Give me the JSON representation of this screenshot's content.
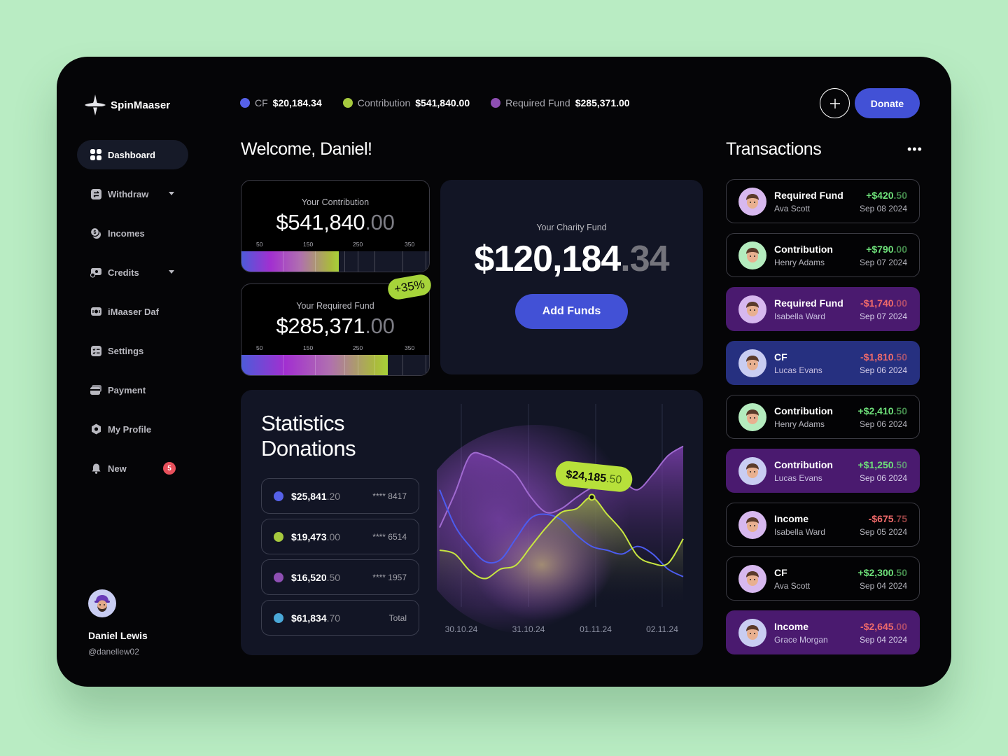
{
  "app": {
    "name": "SpinMaaser",
    "logo_icon": "compass-star-icon"
  },
  "sidebar": {
    "items": [
      {
        "label": "Dashboard",
        "icon": "grid-icon",
        "active": true
      },
      {
        "label": "Withdraw",
        "icon": "swap-icon",
        "has_dropdown": true
      },
      {
        "label": "Incomes",
        "icon": "coins-icon"
      },
      {
        "label": "Credits",
        "icon": "credit-icon",
        "has_dropdown": true
      },
      {
        "label": "iMaaser Daf",
        "icon": "cash-icon"
      },
      {
        "label": "Settings",
        "icon": "checklist-icon"
      },
      {
        "label": "Payment",
        "icon": "card-icon"
      },
      {
        "label": "My Profile",
        "icon": "hexagon-icon"
      },
      {
        "label": "New",
        "icon": "bell-icon",
        "badge": "5"
      }
    ],
    "user": {
      "name": "Daniel Lewis",
      "handle": "@danellew02"
    }
  },
  "topbar": {
    "stats": [
      {
        "label": "CF",
        "value": "$20,184.34",
        "color": "#5661e8"
      },
      {
        "label": "Contribution",
        "value": "$541,840.00",
        "color": "#a6c93e"
      },
      {
        "label": "Required Fund",
        "value": "$285,371.00",
        "color": "#8e4fb3"
      }
    ],
    "donate_label": "Donate"
  },
  "welcome": "Welcome, Daniel!",
  "contribution_card": {
    "title": "Your Contribution",
    "amount_int": "$541,840",
    "amount_dec": ".00",
    "scale": [
      "50",
      "150",
      "250",
      "350"
    ],
    "progress": 0.52
  },
  "required_card": {
    "title": "Your Required Fund",
    "amount_int": "$285,371",
    "amount_dec": ".00",
    "scale": [
      "50",
      "150",
      "250",
      "350"
    ],
    "progress": 0.78,
    "change_badge": "+35%"
  },
  "charity_card": {
    "title": "Your Charity Fund",
    "amount_int": "$120,184",
    "amount_dec": ".34",
    "button": "Add Funds"
  },
  "statistics": {
    "title_line1": "Statistics",
    "title_line2": "Donations",
    "legend": [
      {
        "int": "$25,841",
        "dec": ".20",
        "card": "**** 8417",
        "color": "#5661e8"
      },
      {
        "int": "$19,473",
        "dec": ".00",
        "card": "**** 6514",
        "color": "#a6c93e"
      },
      {
        "int": "$16,520",
        "dec": ".50",
        "card": "**** 1957",
        "color": "#8e4fb3"
      },
      {
        "int": "$61,834",
        "dec": ".70",
        "card": "Total",
        "color": "#4aa8d8"
      }
    ]
  },
  "chart_data": {
    "type": "line",
    "x": [
      "30.10.24",
      "31.10.24",
      "01.11.24",
      "02.11.24"
    ],
    "tooltip": {
      "value_int": "$24,185",
      "value_dec": ".50",
      "series": "Green"
    },
    "series": [
      {
        "name": "Purple",
        "color": "#a06ad0",
        "values": [
          42,
          60,
          80,
          80,
          76,
          70,
          58,
          50,
          52,
          58,
          63,
          64,
          66,
          62,
          70,
          80,
          85
        ]
      },
      {
        "name": "Blue",
        "color": "#4c5cf0",
        "values": [
          62,
          43,
          32,
          24,
          25,
          36,
          47,
          49,
          46,
          38,
          32,
          30,
          28,
          32,
          28,
          20,
          16
        ]
      },
      {
        "name": "Green",
        "color": "#c8e640",
        "values": [
          30,
          28,
          19,
          15,
          20,
          22,
          32,
          42,
          50,
          52,
          58,
          49,
          40,
          27,
          23,
          23,
          36
        ]
      }
    ],
    "ylim": [
      0,
      100
    ]
  },
  "transactions": {
    "title": "Transactions",
    "items": [
      {
        "type": "Required Fund",
        "name": "Ava Scott",
        "int": "+$420",
        "dec": ".50",
        "date": "Sep 08 2024",
        "sign": "pos",
        "style": "plain",
        "avatar_bg": "#d7b8ef"
      },
      {
        "type": "Contribution",
        "name": "Henry Adams",
        "int": "+$790",
        "dec": ".00",
        "date": "Sep 07 2024",
        "sign": "pos",
        "style": "plain",
        "avatar_bg": "#b4ecbe"
      },
      {
        "type": "Required Fund",
        "name": "Isabella Ward",
        "int": "-$1,740",
        "dec": ".00",
        "date": "Sep 07 2024",
        "sign": "neg",
        "style": "purple",
        "avatar_bg": "#d7b8ef"
      },
      {
        "type": "CF",
        "name": "Lucas Evans",
        "int": "-$1,810",
        "dec": ".50",
        "date": "Sep 06 2024",
        "sign": "neg",
        "style": "blue",
        "avatar_bg": "#c9cdf2"
      },
      {
        "type": "Contribution",
        "name": "Henry Adams",
        "int": "+$2,410",
        "dec": ".50",
        "date": "Sep 06 2024",
        "sign": "pos",
        "style": "plain",
        "avatar_bg": "#b4ecbe"
      },
      {
        "type": "Contribution",
        "name": "Lucas Evans",
        "int": "+$1,250",
        "dec": ".50",
        "date": "Sep 06 2024",
        "sign": "pos",
        "style": "purple",
        "avatar_bg": "#c9cdf2"
      },
      {
        "type": "Income",
        "name": "Isabella Ward",
        "int": "-$675",
        "dec": ".75",
        "date": "Sep 05 2024",
        "sign": "neg",
        "style": "plain",
        "avatar_bg": "#d7b8ef"
      },
      {
        "type": "CF",
        "name": "Ava Scott",
        "int": "+$2,300",
        "dec": ".50",
        "date": "Sep 04 2024",
        "sign": "pos",
        "style": "plain",
        "avatar_bg": "#d7b8ef"
      },
      {
        "type": "Income",
        "name": "Grace Morgan",
        "int": "-$2,645",
        "dec": ".00",
        "date": "Sep 04 2024",
        "sign": "neg",
        "style": "purple",
        "avatar_bg": "#c9cdf2"
      }
    ]
  }
}
